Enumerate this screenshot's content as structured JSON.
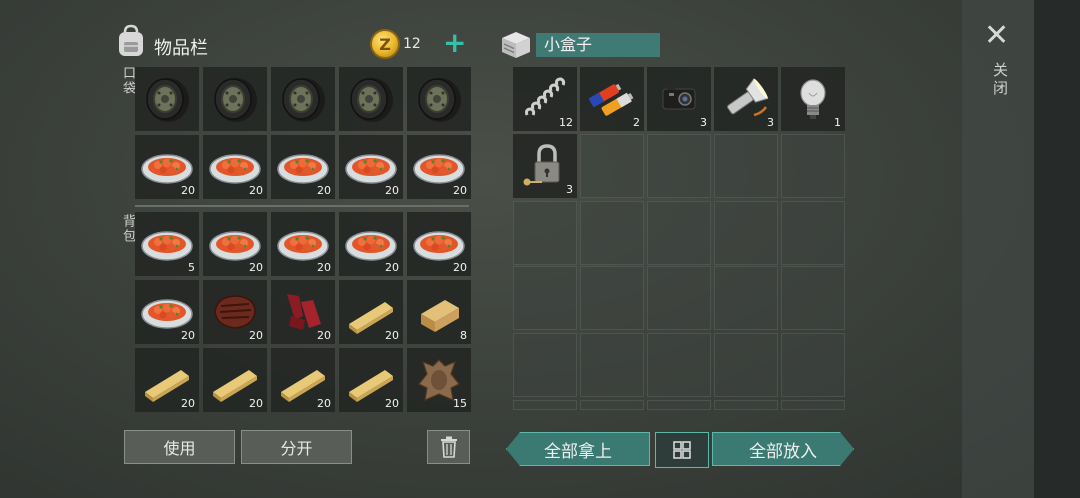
{
  "inventory": {
    "title": "物品栏",
    "coin_count": "12",
    "coin_symbol": "Z",
    "add_symbol": "+",
    "pocket_label": "口袋",
    "backpack_label": "背包"
  },
  "pocket": [
    {
      "item": "tire",
      "count": ""
    },
    {
      "item": "tire",
      "count": ""
    },
    {
      "item": "tire",
      "count": ""
    },
    {
      "item": "tire",
      "count": ""
    },
    {
      "item": "tire",
      "count": ""
    },
    {
      "item": "stew",
      "count": "20"
    },
    {
      "item": "stew",
      "count": "20"
    },
    {
      "item": "stew",
      "count": "20"
    },
    {
      "item": "stew",
      "count": "20"
    },
    {
      "item": "stew",
      "count": "20"
    }
  ],
  "backpack": [
    {
      "item": "stew",
      "count": "5"
    },
    {
      "item": "stew",
      "count": "20"
    },
    {
      "item": "stew",
      "count": "20"
    },
    {
      "item": "stew",
      "count": "20"
    },
    {
      "item": "stew",
      "count": "20"
    },
    {
      "item": "stew",
      "count": "20"
    },
    {
      "item": "steak",
      "count": "20"
    },
    {
      "item": "jerky",
      "count": "20"
    },
    {
      "item": "plank",
      "count": "20"
    },
    {
      "item": "log",
      "count": "8"
    },
    {
      "item": "plank",
      "count": "20"
    },
    {
      "item": "plank",
      "count": "20"
    },
    {
      "item": "plank",
      "count": "20"
    },
    {
      "item": "plank",
      "count": "20"
    },
    {
      "item": "hide",
      "count": "15"
    }
  ],
  "box": {
    "title": "小盒子",
    "slots": [
      {
        "item": "spring",
        "count": "12"
      },
      {
        "item": "batteries",
        "count": "2"
      },
      {
        "item": "camera",
        "count": "3"
      },
      {
        "item": "flashlight",
        "count": "3"
      },
      {
        "item": "lightbulb",
        "count": "1"
      },
      {
        "item": "padlock",
        "count": "3"
      },
      {
        "item": "",
        "count": ""
      },
      {
        "item": "",
        "count": ""
      },
      {
        "item": "",
        "count": ""
      },
      {
        "item": "",
        "count": ""
      },
      {
        "item": "",
        "count": ""
      },
      {
        "item": "",
        "count": ""
      },
      {
        "item": "",
        "count": ""
      },
      {
        "item": "",
        "count": ""
      },
      {
        "item": "",
        "count": ""
      }
    ]
  },
  "buttons": {
    "use": "使用",
    "split": "分开",
    "take_all": "全部拿上",
    "put_all": "全部放入"
  },
  "close": {
    "symbol": "✕",
    "label": "关闭"
  },
  "colors": {
    "accent_teal": "#3a7a72",
    "coin_gold": "#e8b62a",
    "plus_green": "#35c0a8"
  }
}
